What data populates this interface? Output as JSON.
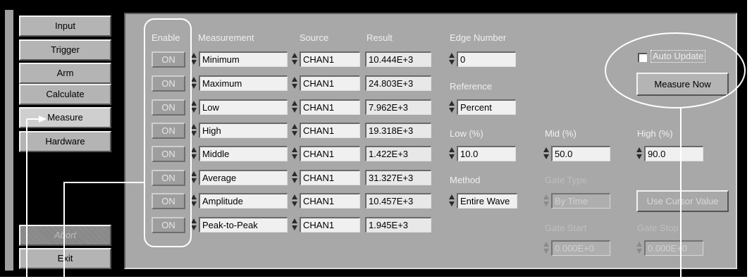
{
  "nav": {
    "input": "Input",
    "trigger": "Trigger",
    "arm": "Arm",
    "calculate": "Calculate",
    "measure": "Measure",
    "hardware": "Hardware",
    "abort": "Abort",
    "exit": "Exit"
  },
  "headers": {
    "enable": "Enable",
    "measurement": "Measurement",
    "source": "Source",
    "result": "Result",
    "edge_number": "Edge Number",
    "reference": "Reference",
    "low": "Low (%)",
    "mid": "Mid (%)",
    "high": "High (%)",
    "method": "Method",
    "gate_type": "Gate Type",
    "gate_start": "Gate Start",
    "gate_stop": "Gate Stop"
  },
  "rows": [
    {
      "enable": "ON",
      "measurement": "Minimum",
      "source": "CHAN1",
      "result": "10.444E+3"
    },
    {
      "enable": "ON",
      "measurement": "Maximum",
      "source": "CHAN1",
      "result": "24.803E+3"
    },
    {
      "enable": "ON",
      "measurement": "Low",
      "source": "CHAN1",
      "result": "7.962E+3"
    },
    {
      "enable": "ON",
      "measurement": "High",
      "source": "CHAN1",
      "result": "19.318E+3"
    },
    {
      "enable": "ON",
      "measurement": "Middle",
      "source": "CHAN1",
      "result": "1.422E+3"
    },
    {
      "enable": "ON",
      "measurement": "Average",
      "source": "CHAN1",
      "result": "31.327E+3"
    },
    {
      "enable": "ON",
      "measurement": "Amplitude",
      "source": "CHAN1",
      "result": "10.457E+3"
    },
    {
      "enable": "ON",
      "measurement": "Peak-to-Peak",
      "source": "CHAN1",
      "result": "1.945E+3"
    }
  ],
  "settings": {
    "edge_number": "0",
    "reference": "Percent",
    "low": "10.0",
    "mid": "50.0",
    "high": "90.0",
    "method": "Entire Wave",
    "gate_type": "By Time",
    "gate_start": "0.000E+0",
    "gate_stop": "0.000E+0"
  },
  "controls": {
    "auto_update": "Auto Update",
    "measure_now": "Measure Now",
    "use_cursor_value": "Use Cursor Value"
  },
  "colors": {
    "panel": "#a8a8a8",
    "button": "#b4b4b4",
    "label": "#f0f0f0"
  }
}
